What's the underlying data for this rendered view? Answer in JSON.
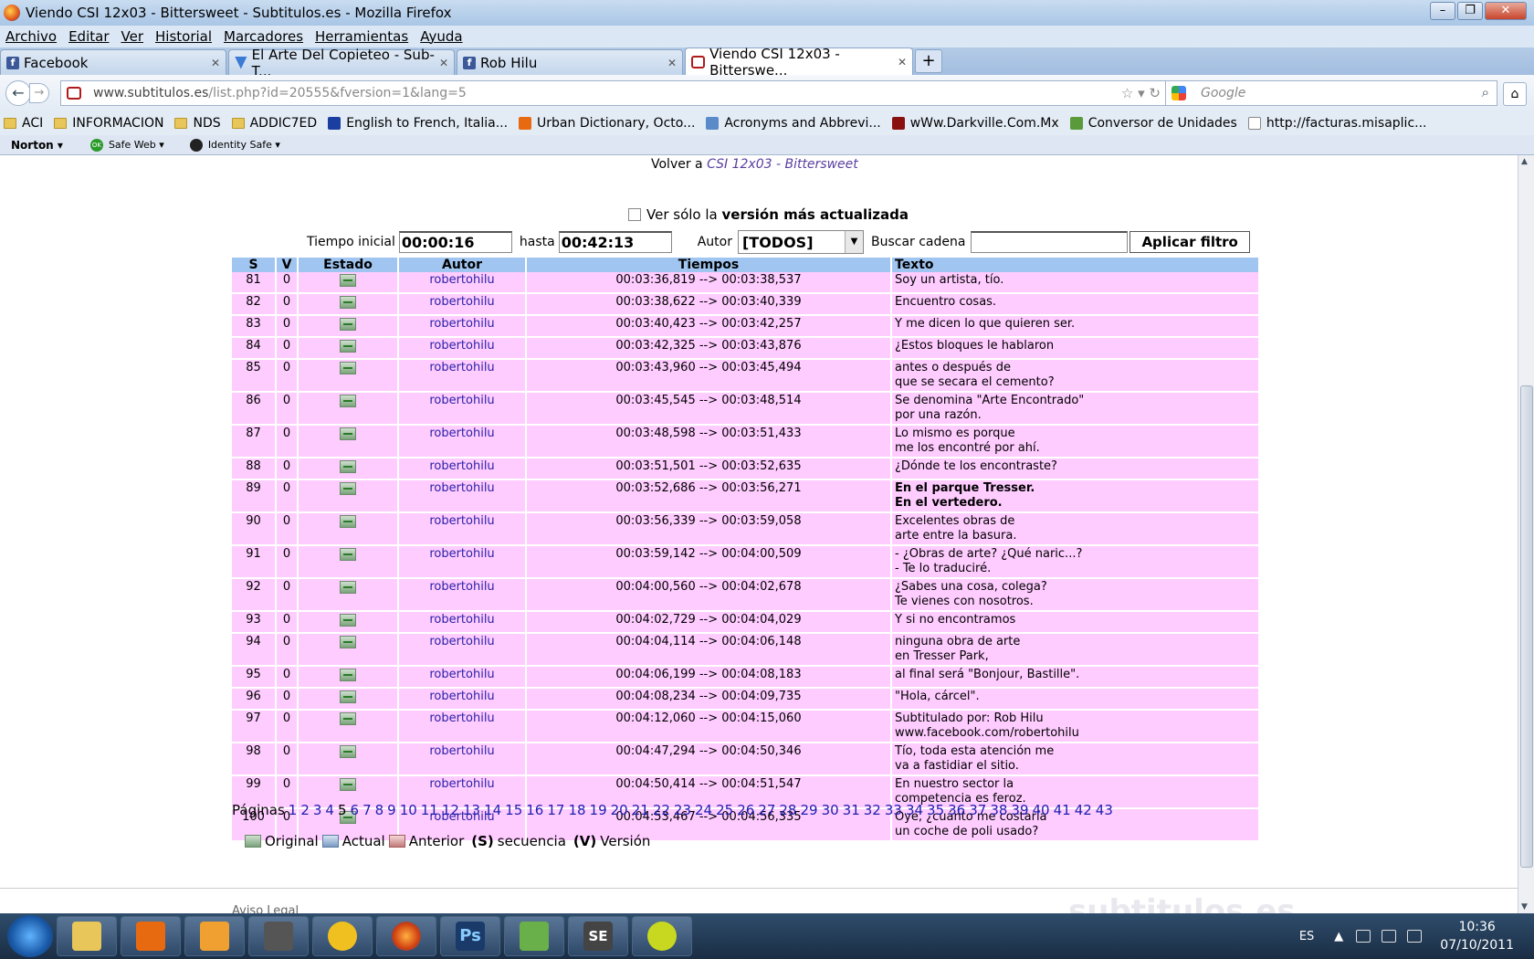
{
  "window": {
    "title": "Viendo CSI 12x03 - Bittersweet - Subtitulos.es - Mozilla Firefox"
  },
  "menu": [
    "Archivo",
    "Editar",
    "Ver",
    "Historial",
    "Marcadores",
    "Herramientas",
    "Ayuda"
  ],
  "tabs": [
    {
      "label": "Facebook",
      "icon": "facebook-icon"
    },
    {
      "label": "El Arte Del Copieteo - Sub-T...",
      "icon": "wordpress-icon"
    },
    {
      "label": "Rob Hilu",
      "icon": "facebook-icon"
    },
    {
      "label": "Viendo CSI 12x03 - Bitterswe...",
      "icon": "tv-icon",
      "active": true
    }
  ],
  "nav": {
    "url_host": "www.subtitulos.es",
    "url_path": "/list.php?id=20555&fversion=1&lang=5",
    "search_placeholder": "Google"
  },
  "bookmarks": [
    "ACI",
    "INFORMACION",
    "NDS",
    "ADDIC7ED",
    "English to French, Italia...",
    "Urban Dictionary, Octo...",
    "Acronyms and Abbrevi...",
    "wWw.Darkville.Com.Mx",
    "Conversor de Unidades",
    "http://facturas.misaplic..."
  ],
  "norton": {
    "brand": "Norton",
    "safe_web": "Safe Web",
    "identity": "Identity Safe"
  },
  "page": {
    "volver_prefix": "Volver a",
    "volver_link": "CSI 12x03 - Bittersweet",
    "checkbox_pre": "Ver sólo la",
    "checkbox_bold": "versión más actualizada",
    "tiempo_label": "Tiempo inicial",
    "tiempo_value": "00:00:16",
    "hasta_label": "hasta",
    "hasta_value": "00:42:13",
    "autor_label": "Autor",
    "autor_value": "[TODOS]",
    "buscar_label": "Buscar cadena",
    "buscar_value": "",
    "apply_label": "Aplicar filtro"
  },
  "table": {
    "headers": [
      "S",
      "V",
      "Estado",
      "Autor",
      "Tiempos",
      "Texto"
    ],
    "rows": [
      {
        "s": "81",
        "v": "0",
        "autor": "robertohilu",
        "t": "00:03:36,819 --> 00:03:38,537",
        "l1": "Soy un artista, tío.",
        "l2": ""
      },
      {
        "s": "82",
        "v": "0",
        "autor": "robertohilu",
        "t": "00:03:38,622 --> 00:03:40,339",
        "l1": "Encuentro cosas.",
        "l2": ""
      },
      {
        "s": "83",
        "v": "0",
        "autor": "robertohilu",
        "t": "00:03:40,423 --> 00:03:42,257",
        "l1": "Y me dicen lo que quieren ser.",
        "l2": ""
      },
      {
        "s": "84",
        "v": "0",
        "autor": "robertohilu",
        "t": "00:03:42,325 --> 00:03:43,876",
        "l1": "¿Estos bloques le hablaron",
        "l2": ""
      },
      {
        "s": "85",
        "v": "0",
        "autor": "robertohilu",
        "t": "00:03:43,960 --> 00:03:45,494",
        "l1": "antes o después de",
        "l2": "que se secara el cemento?"
      },
      {
        "s": "86",
        "v": "0",
        "autor": "robertohilu",
        "t": "00:03:45,545 --> 00:03:48,514",
        "l1": "Se denomina \"Arte Encontrado\"",
        "l2": "por una razón."
      },
      {
        "s": "87",
        "v": "0",
        "autor": "robertohilu",
        "t": "00:03:48,598 --> 00:03:51,433",
        "l1": "Lo mismo es porque",
        "l2": "me los encontré por ahí."
      },
      {
        "s": "88",
        "v": "0",
        "autor": "robertohilu",
        "t": "00:03:51,501 --> 00:03:52,635",
        "l1": "¿Dónde te los encontraste?",
        "l2": ""
      },
      {
        "s": "89",
        "v": "0",
        "autor": "robertohilu",
        "t": "00:03:52,686 --> 00:03:56,271",
        "l1": "En el parque Tresser.",
        "l2": "En el vertedero.",
        "bold": true
      },
      {
        "s": "90",
        "v": "0",
        "autor": "robertohilu",
        "t": "00:03:56,339 --> 00:03:59,058",
        "l1": "Excelentes obras de",
        "l2": "arte entre la basura."
      },
      {
        "s": "91",
        "v": "0",
        "autor": "robertohilu",
        "t": "00:03:59,142 --> 00:04:00,509",
        "l1": "- ¿Obras de arte? ¿Qué naric...?",
        "l2": "- Te lo traduciré."
      },
      {
        "s": "92",
        "v": "0",
        "autor": "robertohilu",
        "t": "00:04:00,560 --> 00:04:02,678",
        "l1": "¿Sabes una cosa, colega?",
        "l2": "Te vienes con nosotros."
      },
      {
        "s": "93",
        "v": "0",
        "autor": "robertohilu",
        "t": "00:04:02,729 --> 00:04:04,029",
        "l1": "Y si no encontramos",
        "l2": ""
      },
      {
        "s": "94",
        "v": "0",
        "autor": "robertohilu",
        "t": "00:04:04,114 --> 00:04:06,148",
        "l1": "ninguna obra de arte",
        "l2": "en Tresser Park,"
      },
      {
        "s": "95",
        "v": "0",
        "autor": "robertohilu",
        "t": "00:04:06,199 --> 00:04:08,183",
        "l1": "al final será \"Bonjour, Bastille\".",
        "l2": ""
      },
      {
        "s": "96",
        "v": "0",
        "autor": "robertohilu",
        "t": "00:04:08,234 --> 00:04:09,735",
        "l1": "\"Hola, cárcel\".",
        "l2": ""
      },
      {
        "s": "97",
        "v": "0",
        "autor": "robertohilu",
        "t": "00:04:12,060 --> 00:04:15,060",
        "l1": "Subtitulado por: Rob Hilu",
        "l2": "www.facebook.com/robertohilu"
      },
      {
        "s": "98",
        "v": "0",
        "autor": "robertohilu",
        "t": "00:04:47,294 --> 00:04:50,346",
        "l1": "Tío, toda esta atención me",
        "l2": "va a fastidiar el sitio."
      },
      {
        "s": "99",
        "v": "0",
        "autor": "robertohilu",
        "t": "00:04:50,414 --> 00:04:51,547",
        "l1": "En nuestro sector la",
        "l2": "competencia es feroz."
      },
      {
        "s": "100",
        "v": "0",
        "autor": "robertohilu",
        "t": "00:04:53,467 --> 00:04:56,335",
        "l1": "Oye, ¿cuánto me costaría",
        "l2": "un coche de poli usado?"
      }
    ]
  },
  "pagination": {
    "label": "Páginas",
    "current": "5",
    "pages": [
      "1",
      "2",
      "3",
      "4",
      "5",
      "6",
      "7",
      "8",
      "9",
      "10",
      "11",
      "12",
      "13",
      "14",
      "15",
      "16",
      "17",
      "18",
      "19",
      "20",
      "21",
      "22",
      "23",
      "24",
      "25",
      "26",
      "27",
      "28",
      "29",
      "30",
      "31",
      "32",
      "33",
      "34",
      "35",
      "36",
      "37",
      "38",
      "39",
      "40",
      "41",
      "42",
      "43"
    ]
  },
  "legend": {
    "original": "Original",
    "actual": "Actual",
    "anterior": "Anterior",
    "s_key": "(S)",
    "s_label": "secuencia",
    "v_key": "(V)",
    "v_label": "Versión"
  },
  "footer": {
    "aviso": "Aviso Legal",
    "brand": "subtitulos.es"
  },
  "taskbar": {
    "lang": "ES",
    "time": "10:36",
    "date": "07/10/2011",
    "apps": [
      "explorer",
      "media-player",
      "outlook",
      "movie-maker",
      "mediamonkey",
      "firefox",
      "photoshop",
      "messenger",
      "se",
      "quicktime"
    ]
  }
}
